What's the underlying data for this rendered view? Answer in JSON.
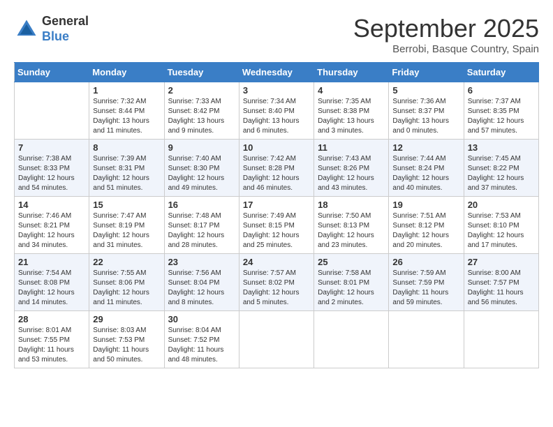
{
  "header": {
    "logo_general": "General",
    "logo_blue": "Blue",
    "month_title": "September 2025",
    "location": "Berrobi, Basque Country, Spain"
  },
  "days_of_week": [
    "Sunday",
    "Monday",
    "Tuesday",
    "Wednesday",
    "Thursday",
    "Friday",
    "Saturday"
  ],
  "weeks": [
    [
      {
        "day": "",
        "sunrise": "",
        "sunset": "",
        "daylight": ""
      },
      {
        "day": "1",
        "sunrise": "Sunrise: 7:32 AM",
        "sunset": "Sunset: 8:44 PM",
        "daylight": "Daylight: 13 hours and 11 minutes."
      },
      {
        "day": "2",
        "sunrise": "Sunrise: 7:33 AM",
        "sunset": "Sunset: 8:42 PM",
        "daylight": "Daylight: 13 hours and 9 minutes."
      },
      {
        "day": "3",
        "sunrise": "Sunrise: 7:34 AM",
        "sunset": "Sunset: 8:40 PM",
        "daylight": "Daylight: 13 hours and 6 minutes."
      },
      {
        "day": "4",
        "sunrise": "Sunrise: 7:35 AM",
        "sunset": "Sunset: 8:38 PM",
        "daylight": "Daylight: 13 hours and 3 minutes."
      },
      {
        "day": "5",
        "sunrise": "Sunrise: 7:36 AM",
        "sunset": "Sunset: 8:37 PM",
        "daylight": "Daylight: 13 hours and 0 minutes."
      },
      {
        "day": "6",
        "sunrise": "Sunrise: 7:37 AM",
        "sunset": "Sunset: 8:35 PM",
        "daylight": "Daylight: 12 hours and 57 minutes."
      }
    ],
    [
      {
        "day": "7",
        "sunrise": "Sunrise: 7:38 AM",
        "sunset": "Sunset: 8:33 PM",
        "daylight": "Daylight: 12 hours and 54 minutes."
      },
      {
        "day": "8",
        "sunrise": "Sunrise: 7:39 AM",
        "sunset": "Sunset: 8:31 PM",
        "daylight": "Daylight: 12 hours and 51 minutes."
      },
      {
        "day": "9",
        "sunrise": "Sunrise: 7:40 AM",
        "sunset": "Sunset: 8:30 PM",
        "daylight": "Daylight: 12 hours and 49 minutes."
      },
      {
        "day": "10",
        "sunrise": "Sunrise: 7:42 AM",
        "sunset": "Sunset: 8:28 PM",
        "daylight": "Daylight: 12 hours and 46 minutes."
      },
      {
        "day": "11",
        "sunrise": "Sunrise: 7:43 AM",
        "sunset": "Sunset: 8:26 PM",
        "daylight": "Daylight: 12 hours and 43 minutes."
      },
      {
        "day": "12",
        "sunrise": "Sunrise: 7:44 AM",
        "sunset": "Sunset: 8:24 PM",
        "daylight": "Daylight: 12 hours and 40 minutes."
      },
      {
        "day": "13",
        "sunrise": "Sunrise: 7:45 AM",
        "sunset": "Sunset: 8:22 PM",
        "daylight": "Daylight: 12 hours and 37 minutes."
      }
    ],
    [
      {
        "day": "14",
        "sunrise": "Sunrise: 7:46 AM",
        "sunset": "Sunset: 8:21 PM",
        "daylight": "Daylight: 12 hours and 34 minutes."
      },
      {
        "day": "15",
        "sunrise": "Sunrise: 7:47 AM",
        "sunset": "Sunset: 8:19 PM",
        "daylight": "Daylight: 12 hours and 31 minutes."
      },
      {
        "day": "16",
        "sunrise": "Sunrise: 7:48 AM",
        "sunset": "Sunset: 8:17 PM",
        "daylight": "Daylight: 12 hours and 28 minutes."
      },
      {
        "day": "17",
        "sunrise": "Sunrise: 7:49 AM",
        "sunset": "Sunset: 8:15 PM",
        "daylight": "Daylight: 12 hours and 25 minutes."
      },
      {
        "day": "18",
        "sunrise": "Sunrise: 7:50 AM",
        "sunset": "Sunset: 8:13 PM",
        "daylight": "Daylight: 12 hours and 23 minutes."
      },
      {
        "day": "19",
        "sunrise": "Sunrise: 7:51 AM",
        "sunset": "Sunset: 8:12 PM",
        "daylight": "Daylight: 12 hours and 20 minutes."
      },
      {
        "day": "20",
        "sunrise": "Sunrise: 7:53 AM",
        "sunset": "Sunset: 8:10 PM",
        "daylight": "Daylight: 12 hours and 17 minutes."
      }
    ],
    [
      {
        "day": "21",
        "sunrise": "Sunrise: 7:54 AM",
        "sunset": "Sunset: 8:08 PM",
        "daylight": "Daylight: 12 hours and 14 minutes."
      },
      {
        "day": "22",
        "sunrise": "Sunrise: 7:55 AM",
        "sunset": "Sunset: 8:06 PM",
        "daylight": "Daylight: 12 hours and 11 minutes."
      },
      {
        "day": "23",
        "sunrise": "Sunrise: 7:56 AM",
        "sunset": "Sunset: 8:04 PM",
        "daylight": "Daylight: 12 hours and 8 minutes."
      },
      {
        "day": "24",
        "sunrise": "Sunrise: 7:57 AM",
        "sunset": "Sunset: 8:02 PM",
        "daylight": "Daylight: 12 hours and 5 minutes."
      },
      {
        "day": "25",
        "sunrise": "Sunrise: 7:58 AM",
        "sunset": "Sunset: 8:01 PM",
        "daylight": "Daylight: 12 hours and 2 minutes."
      },
      {
        "day": "26",
        "sunrise": "Sunrise: 7:59 AM",
        "sunset": "Sunset: 7:59 PM",
        "daylight": "Daylight: 11 hours and 59 minutes."
      },
      {
        "day": "27",
        "sunrise": "Sunrise: 8:00 AM",
        "sunset": "Sunset: 7:57 PM",
        "daylight": "Daylight: 11 hours and 56 minutes."
      }
    ],
    [
      {
        "day": "28",
        "sunrise": "Sunrise: 8:01 AM",
        "sunset": "Sunset: 7:55 PM",
        "daylight": "Daylight: 11 hours and 53 minutes."
      },
      {
        "day": "29",
        "sunrise": "Sunrise: 8:03 AM",
        "sunset": "Sunset: 7:53 PM",
        "daylight": "Daylight: 11 hours and 50 minutes."
      },
      {
        "day": "30",
        "sunrise": "Sunrise: 8:04 AM",
        "sunset": "Sunset: 7:52 PM",
        "daylight": "Daylight: 11 hours and 48 minutes."
      },
      {
        "day": "",
        "sunrise": "",
        "sunset": "",
        "daylight": ""
      },
      {
        "day": "",
        "sunrise": "",
        "sunset": "",
        "daylight": ""
      },
      {
        "day": "",
        "sunrise": "",
        "sunset": "",
        "daylight": ""
      },
      {
        "day": "",
        "sunrise": "",
        "sunset": "",
        "daylight": ""
      }
    ]
  ]
}
